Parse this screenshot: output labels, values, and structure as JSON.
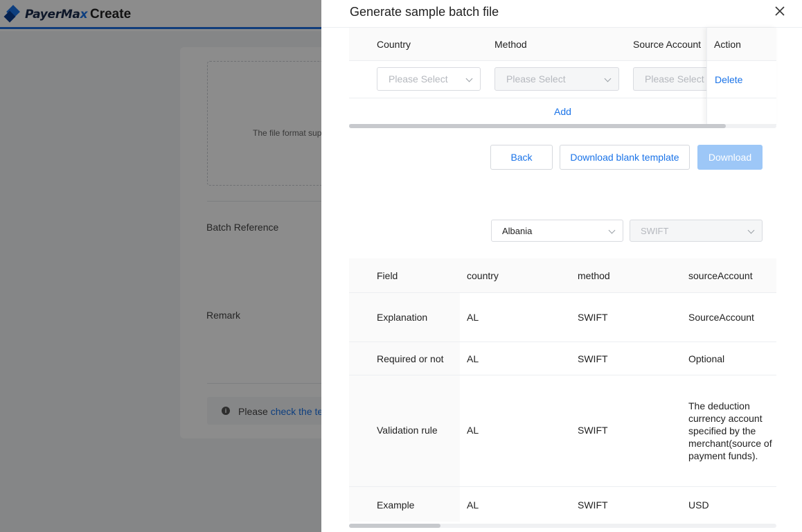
{
  "app": {
    "brand_prefix": "PayerMa",
    "brand_suffix": "x",
    "page_title": "Create"
  },
  "background_form": {
    "upload_hint": "The file format sup",
    "batch_reference_label": "Batch Reference",
    "remark_label": "Remark",
    "notice_text": "Please ",
    "notice_link": "check the te"
  },
  "drawer": {
    "title": "Generate sample batch file",
    "selection_table": {
      "columns": [
        "Country",
        "Method",
        "Source Account",
        "Action"
      ],
      "row": {
        "country_placeholder": "Please Select",
        "method_placeholder": "Please Select",
        "source_account_placeholder": "Please Select",
        "action": "Delete"
      },
      "add_label": "Add"
    },
    "buttons": {
      "back": "Back",
      "download_blank": "Download blank template",
      "download": "Download"
    },
    "filters": {
      "country": "Albania",
      "method": "SWIFT"
    },
    "field_table": {
      "headers": [
        "Field",
        "country",
        "method",
        "sourceAccount"
      ],
      "rows": [
        {
          "field": "Explanation",
          "country": "AL",
          "method": "SWIFT",
          "sourceAccount": "SourceAccount"
        },
        {
          "field": "Required or not",
          "country": "AL",
          "method": "SWIFT",
          "sourceAccount": "Optional"
        },
        {
          "field": "Validation rule",
          "country": "AL",
          "method": "SWIFT",
          "sourceAccount": "The deduction currency account specified by the merchant(source of payment funds)."
        },
        {
          "field": "Example",
          "country": "AL",
          "method": "SWIFT",
          "sourceAccount": "USD"
        }
      ]
    }
  },
  "colors": {
    "accent": "#1a73e8",
    "overlay": "rgba(0,0,0,0.45)",
    "disabled_primary": "#9dc7f7"
  }
}
